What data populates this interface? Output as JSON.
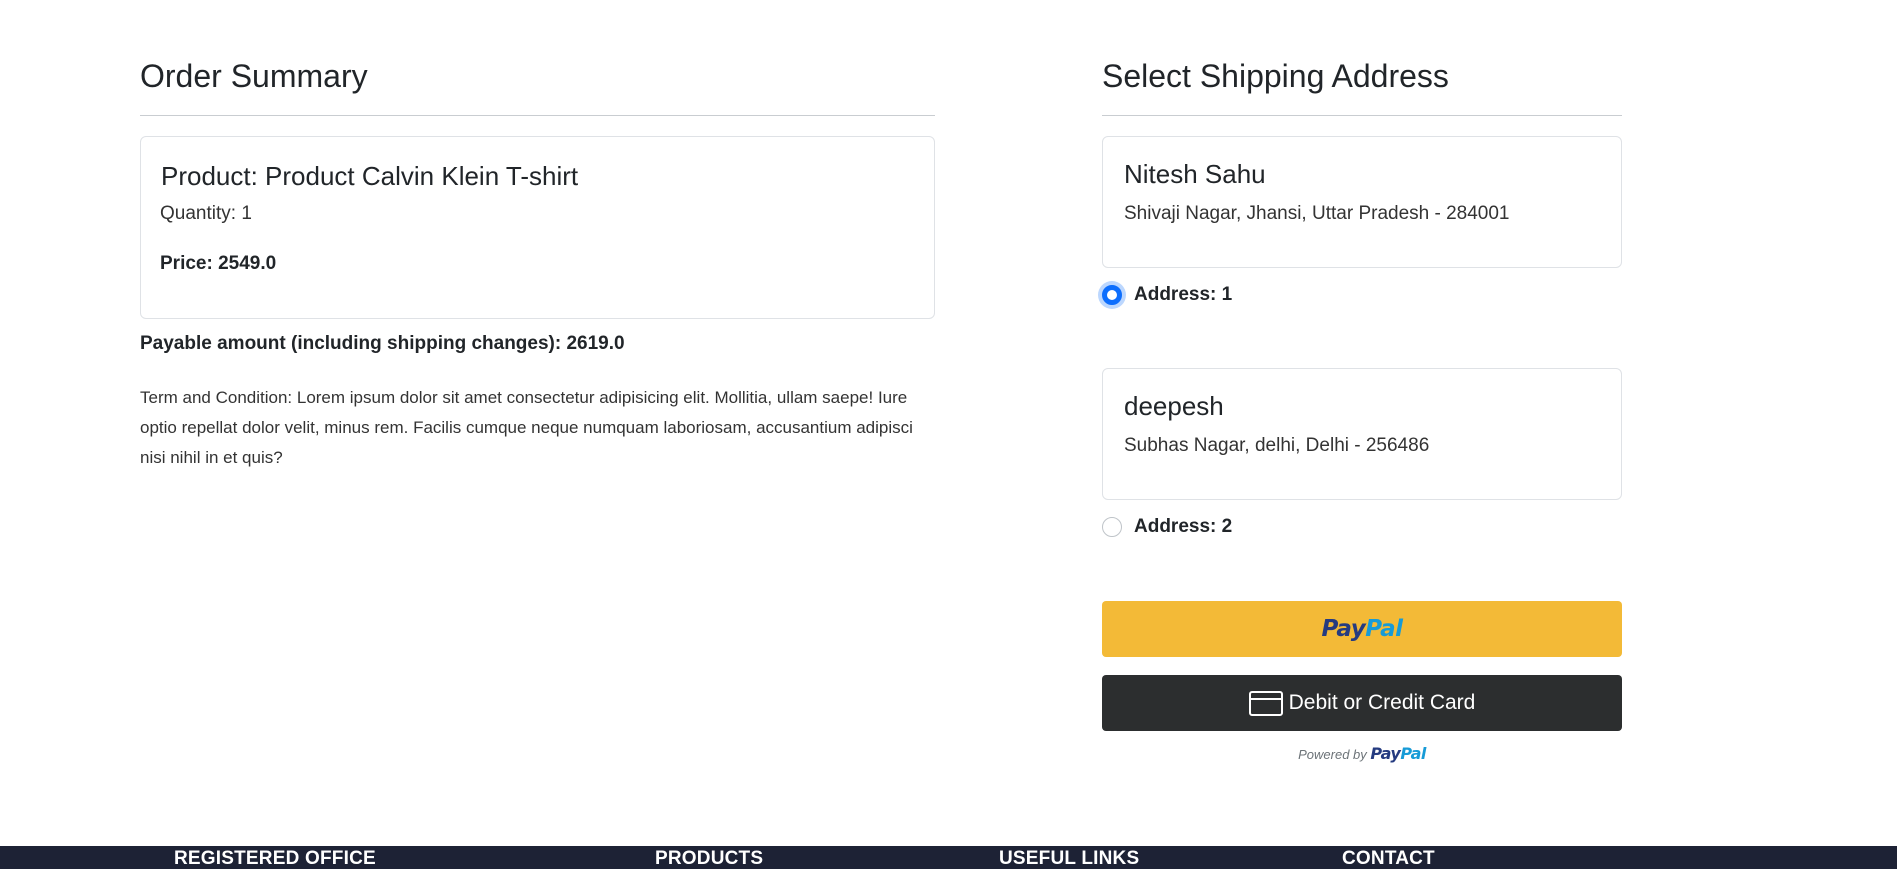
{
  "order_summary": {
    "title": "Order Summary",
    "product_name": "Product: Product Calvin Klein T-shirt",
    "quantity": "Quantity: 1",
    "price": "Price: 2549.0",
    "payable": "Payable amount (including shipping changes): 2619.0",
    "terms": "Term and Condition: Lorem ipsum dolor sit amet consectetur adipisicing elit. Mollitia, ullam saepe! Iure optio repellat dolor velit, minus rem. Facilis cumque neque numquam laboriosam, accusantium adipisci nisi nihil in et quis?"
  },
  "shipping": {
    "title": "Select Shipping Address",
    "addresses": [
      {
        "name": "Nitesh Sahu",
        "line": "Shivaji Nagar, Jhansi, Uttar Pradesh - 284001",
        "radio_label": "Address: 1",
        "selected": true
      },
      {
        "name": "deepesh",
        "line": "Subhas Nagar, delhi, Delhi - 256486",
        "radio_label": "Address: 2",
        "selected": false
      }
    ]
  },
  "payment": {
    "paypal_pay": "Pay",
    "paypal_pal": "Pal",
    "card_label": "Debit or Credit Card",
    "powered_by": "Powered by"
  },
  "footer": {
    "items": [
      "REGISTERED OFFICE",
      "PRODUCTS",
      "USEFUL LINKS",
      "CONTACT"
    ]
  },
  "colors": {
    "accent": "#0d6efd",
    "paypal_yellow": "#f3ba37",
    "card_button": "#2c2e2f",
    "footer_bg": "#1d2235"
  }
}
